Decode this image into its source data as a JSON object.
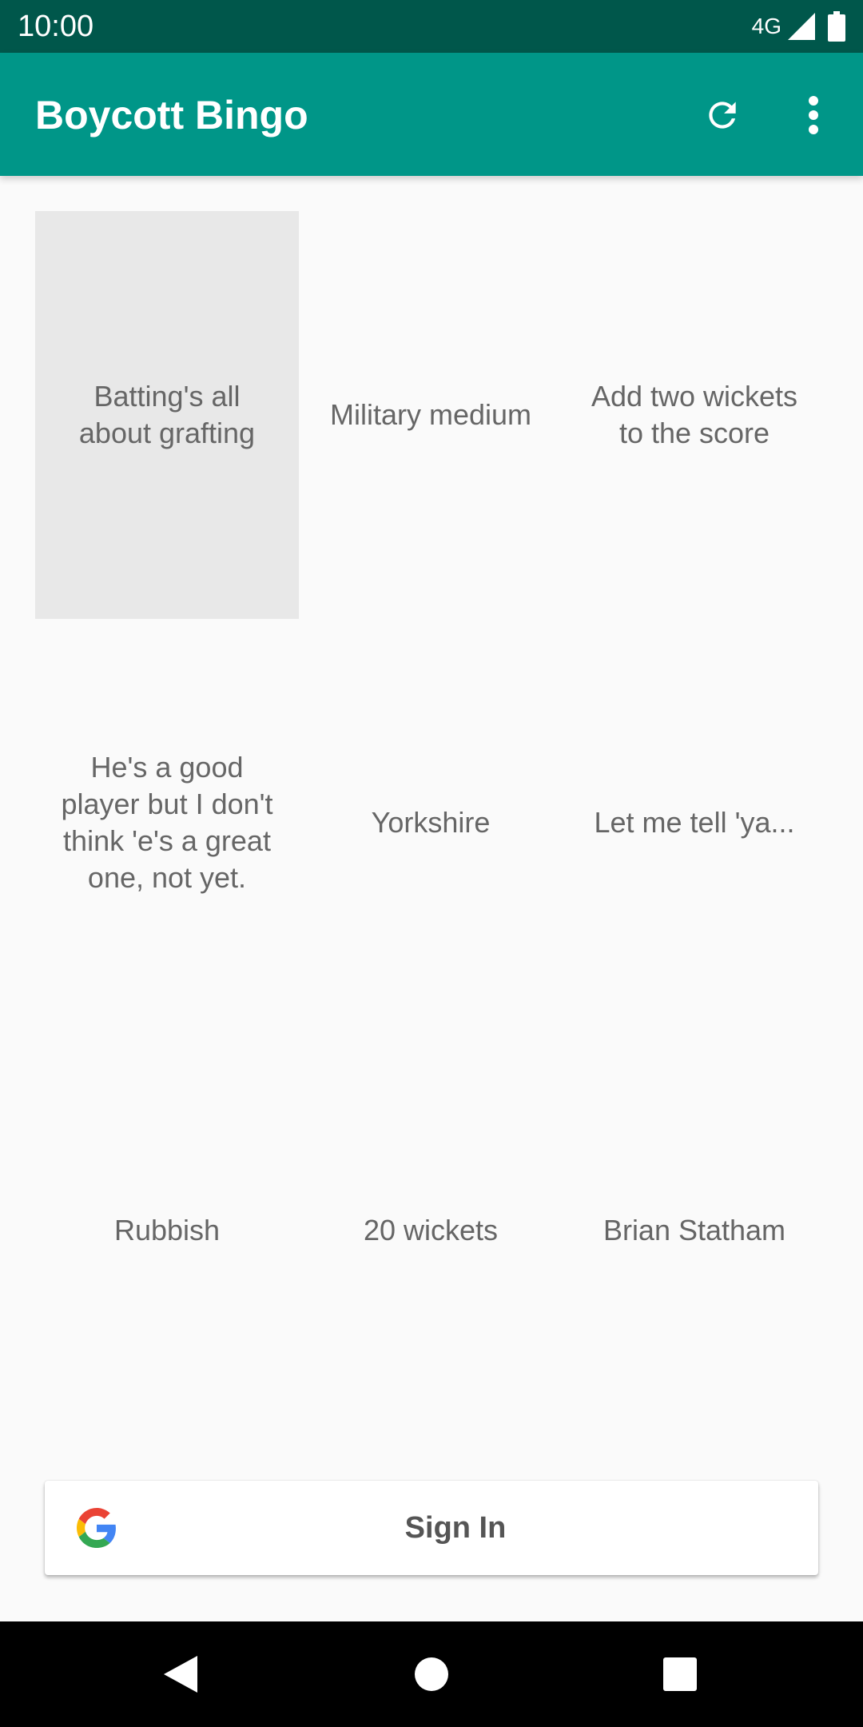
{
  "status_bar": {
    "time": "10:00",
    "network": "4G",
    "icons": [
      "signal-icon",
      "battery-icon"
    ]
  },
  "app_bar": {
    "title": "Boycott Bingo",
    "actions": [
      "refresh-icon",
      "more-vert-icon"
    ],
    "background_color": "#009688",
    "status_color": "#00574b"
  },
  "grid": {
    "cells": [
      {
        "label": "Batting's all about grafting",
        "selected": true
      },
      {
        "label": "Military medium",
        "selected": false
      },
      {
        "label": "Add two wickets to the score",
        "selected": false
      },
      {
        "label": "He's a good player but I don't think 'e's a great one, not yet.",
        "selected": false
      },
      {
        "label": "Yorkshire",
        "selected": false
      },
      {
        "label": "Let me tell 'ya...",
        "selected": false
      },
      {
        "label": "Rubbish",
        "selected": false
      },
      {
        "label": "20 wickets",
        "selected": false
      },
      {
        "label": "Brian Statham",
        "selected": false
      }
    ]
  },
  "sign_in": {
    "label": "Sign In",
    "icon": "google-g-icon"
  },
  "nav_bar": {
    "buttons": [
      "back-icon",
      "home-icon",
      "recents-icon"
    ]
  }
}
